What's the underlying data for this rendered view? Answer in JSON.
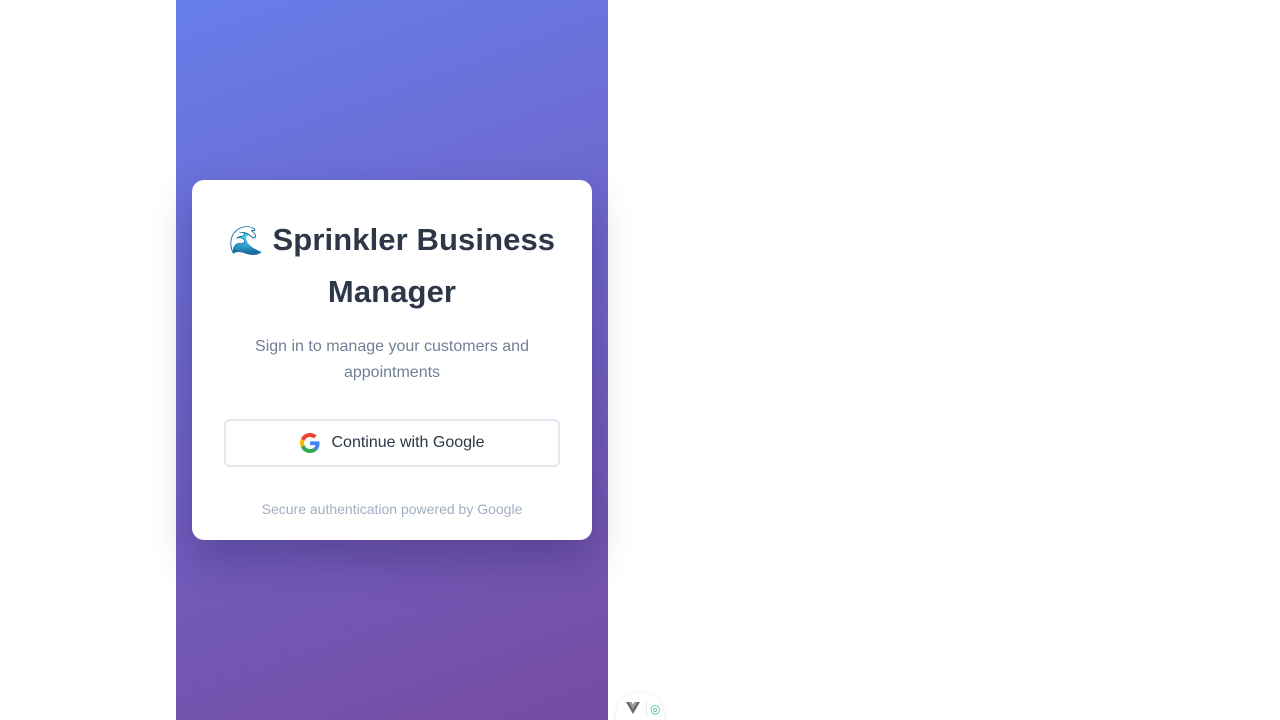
{
  "login": {
    "title_emoji": "🌊",
    "title": "Sprinkler Business Manager",
    "subtitle": "Sign in to manage your customers and appointments",
    "google_button_label": "Continue with Google",
    "footer_note": "Secure authentication powered by Google"
  },
  "icons": {
    "google": "google-g-icon",
    "devtools": "vue-devtools-icon"
  },
  "colors": {
    "gradient_start": "#667eea",
    "gradient_end": "#764ba2",
    "title_text": "#2d3748",
    "subtitle_text": "#718096",
    "footer_text": "#a0aec0",
    "button_border": "#e2e8f0"
  }
}
